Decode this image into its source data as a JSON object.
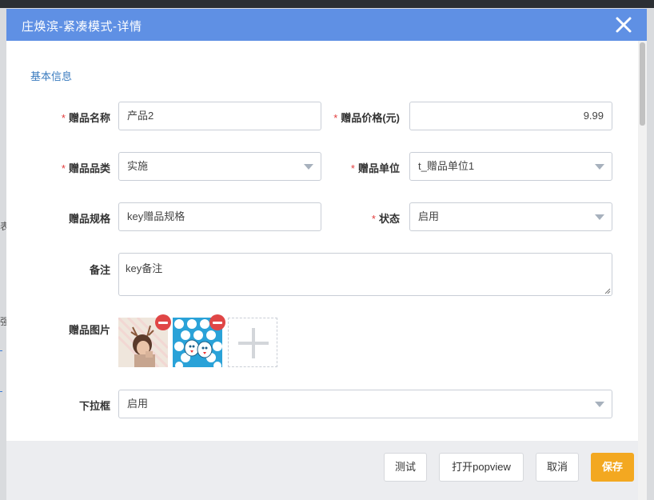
{
  "background": {
    "fragments": [
      "表",
      "强"
    ]
  },
  "dialog": {
    "title": "庄焕滨-紧凑模式-详情",
    "close_icon": "close-icon",
    "section_title": "基本信息",
    "fields": {
      "gift_name": {
        "label": "赠品名称",
        "required": "*",
        "value": "产品2"
      },
      "gift_price": {
        "label": "赠品价格(元)",
        "required": "*",
        "value": "9.99"
      },
      "gift_category": {
        "label": "赠品品类",
        "required": "*",
        "value": "实施"
      },
      "gift_unit": {
        "label": "赠品单位",
        "required": "*",
        "value": "t_赠品单位1"
      },
      "gift_spec": {
        "label": "赠品规格",
        "value": "key赠品规格"
      },
      "status": {
        "label": "状态",
        "required": "*",
        "value": "启用"
      },
      "remark": {
        "label": "备注",
        "value": "key备注"
      },
      "gift_images": {
        "label": "赠品图片",
        "images": [
          "girl-with-antlers-thumbnail",
          "blue-pattern-thumbnail"
        ]
      },
      "dropdown": {
        "label": "下拉框",
        "value": "启用"
      }
    },
    "footer": {
      "test_label": "测试",
      "popview_label": "打开popview",
      "cancel_label": "取消",
      "save_label": "保存"
    },
    "colors": {
      "header": "#5f90e4",
      "required": "#e23d3d",
      "primary_button": "#f3a821",
      "section_title": "#3a7bbf"
    }
  }
}
